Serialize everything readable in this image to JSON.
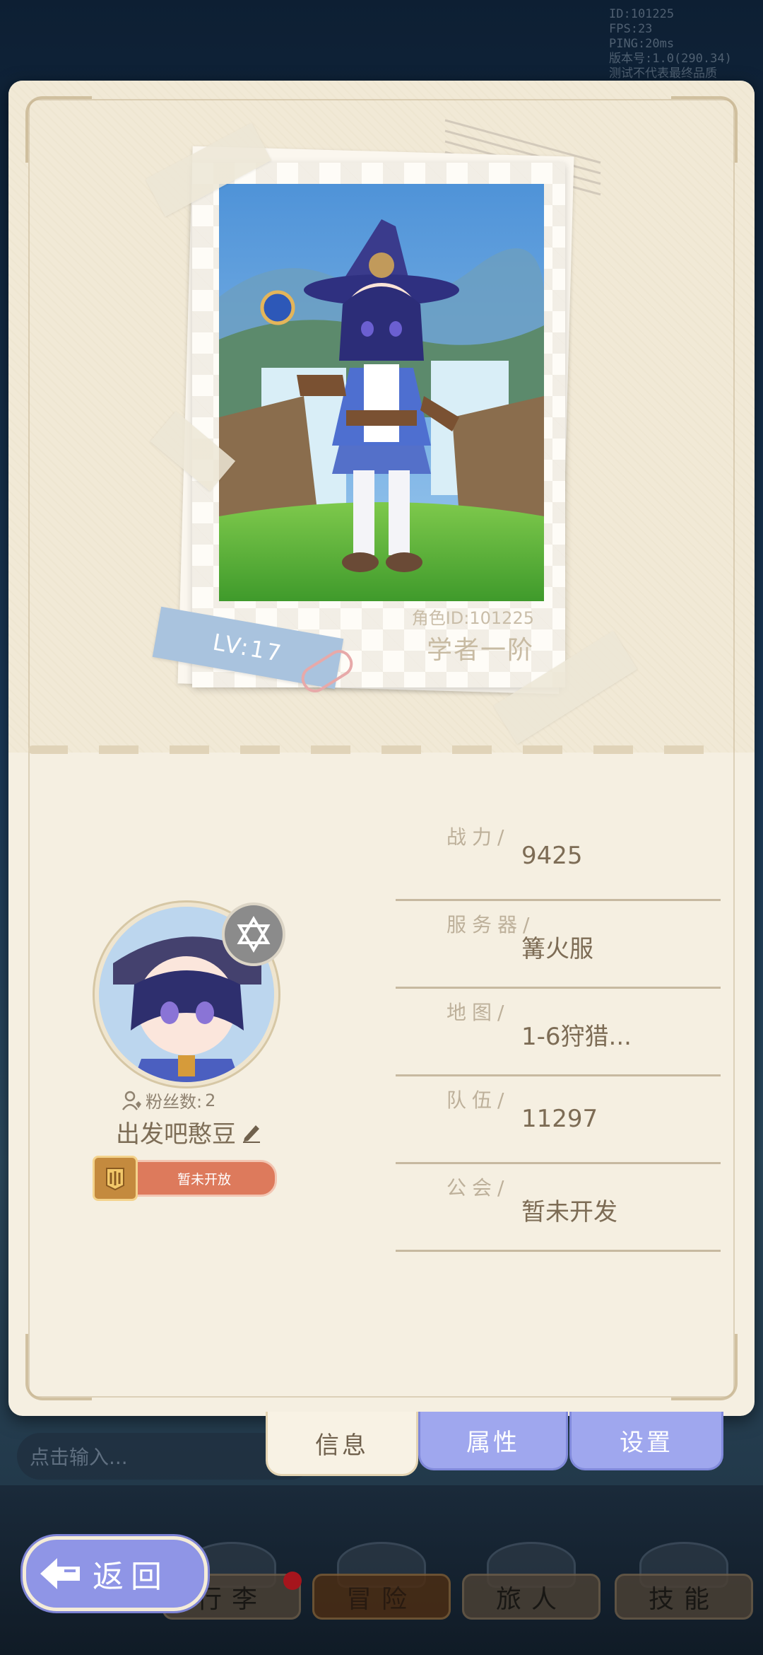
{
  "debug": {
    "lines": [
      "ID:101225",
      "FPS:23",
      "PING:20ms",
      "版本号:1.0(290.34)",
      "测试不代表最终品质"
    ]
  },
  "photo": {
    "level": "LV:17",
    "role_id": "角色ID:101225",
    "class": "学者一阶"
  },
  "profile": {
    "fans_label": "粉丝数:",
    "fans_count": "2",
    "nickname": "出发吧憨豆",
    "guild_status": "暂未开放"
  },
  "stats": [
    {
      "label": "战力/",
      "value": "9425"
    },
    {
      "label": "服务器/",
      "value": "篝火服"
    },
    {
      "label": "地图/",
      "value": "1-6狩猎..."
    },
    {
      "label": "队伍/",
      "value": "11297"
    },
    {
      "label": "公会/",
      "value": "暂未开发"
    }
  ],
  "tabs": {
    "info": "信息",
    "attributes": "属性",
    "settings": "设置"
  },
  "chat": {
    "placeholder": "点击输入..."
  },
  "nav": {
    "items": [
      {
        "label": "行李",
        "badge": true
      },
      {
        "label": "冒险",
        "active": true
      },
      {
        "label": "旅人"
      },
      {
        "label": "技能"
      }
    ],
    "back_label": "返回"
  },
  "colors": {
    "card_bg": "#f5efe1",
    "tab_active": "#f8f2e4",
    "tab_inactive": "#9fa7ee",
    "level_tag": "#a9c3de",
    "guild_pill": "#dd7a5c",
    "back_button": "#8f95e6"
  },
  "icons": {
    "badge": "hexagram-icon",
    "fans": "fans-icon",
    "edit": "pencil-icon",
    "back": "back-arrow-icon",
    "guild": "guild-emblem-icon"
  }
}
